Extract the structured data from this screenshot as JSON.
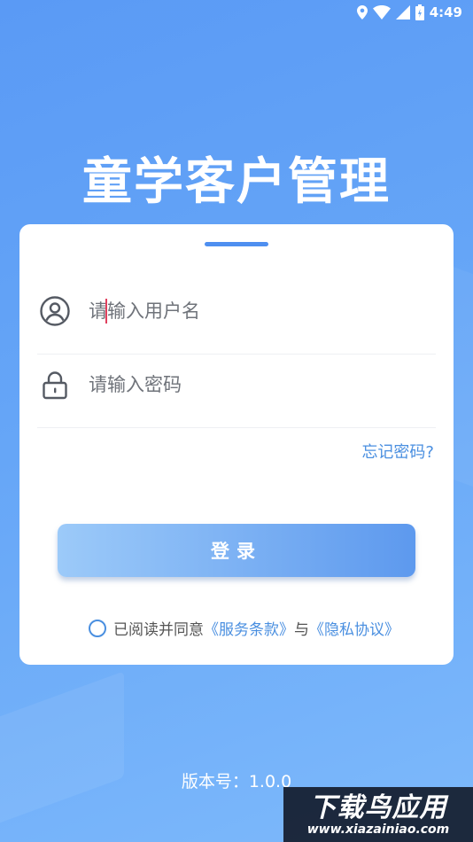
{
  "status_bar": {
    "time": "4:49",
    "icons": [
      "location-icon",
      "wifi-icon",
      "signal-icon",
      "battery-icon"
    ]
  },
  "app": {
    "title": "童学客户管理"
  },
  "login_form": {
    "username_placeholder": "请输入用户名",
    "username_value": "",
    "password_placeholder": "请输入密码",
    "password_value": "",
    "forgot_password": "忘记密码?",
    "login_button": "登录"
  },
  "agreement": {
    "prefix": "已阅读并同意",
    "terms_link": "《服务条款》",
    "conjunction": "与",
    "privacy_link": "《隐私协议》",
    "checked": false
  },
  "footer": {
    "version": "版本号：1.0.0"
  },
  "watermark": {
    "top": "下载鸟应用",
    "bottom": "www.xiazainiao.com"
  },
  "colors": {
    "accent": "#4a8fe0",
    "background_start": "#5a9af5",
    "background_end": "#7db9fb",
    "button_start": "#9ccaf9",
    "button_end": "#5d99ee"
  }
}
